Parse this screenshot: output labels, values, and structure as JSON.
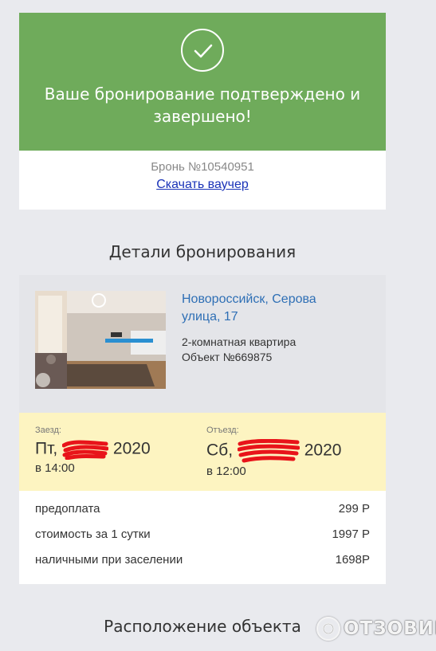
{
  "confirmation": {
    "title_line1": "Ваше бронирование подтверждено и",
    "title_line2": "завершено!",
    "booking_number": "Бронь №10540951",
    "voucher_link": "Скачать ваучер"
  },
  "details": {
    "section_title": "Детали бронирования",
    "address_line1": "Новороссийск, Серова",
    "address_line2": "улица, 17",
    "object_type": "2-комнатная квартира",
    "object_id": "Объект №669875"
  },
  "dates": {
    "checkin_label": "Заезд:",
    "checkin_day": "Пт,",
    "checkin_year": "2020",
    "checkin_time": "в 14:00",
    "checkout_label": "Отъезд:",
    "checkout_day": "Сб,",
    "checkout_year": "2020",
    "checkout_time": "в 12:00"
  },
  "prices": [
    {
      "label": "предоплата",
      "value": "299 Р"
    },
    {
      "label": "стоимость за 1 сутки",
      "value": "1997 Р"
    },
    {
      "label": "наличными при заселении",
      "value": "1698Р"
    }
  ],
  "location": {
    "section_title": "Расположение объекта"
  },
  "watermark": {
    "text": "ОТЗОВИК"
  },
  "colors": {
    "banner_green": "#6fab5b",
    "dates_yellow": "#fdf4c1",
    "link_blue": "#2e6fb5",
    "scribble_red": "#e8141a"
  }
}
